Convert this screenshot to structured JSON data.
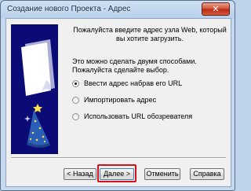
{
  "window": {
    "title": "Создание нового Проекта - Адрес",
    "close_glyph": "✕"
  },
  "wizard": {
    "intro_text": "Пожалуйста введите адрес узла Web, который вы хотите загрузить.",
    "method_text": "Это можно сделать двумя способами. Пожалуйста сделайте выбор.",
    "options": [
      {
        "label": "Ввести адрес набрав его URL",
        "checked": true
      },
      {
        "label": "Импортировать адрес",
        "checked": false
      },
      {
        "label": "Использовать URL обозревателя",
        "checked": false
      }
    ]
  },
  "buttons": {
    "back": "< Назад",
    "next": "Далее >",
    "cancel": "Отменить",
    "help": "Справка"
  },
  "colors": {
    "art_background": "#0b0b78",
    "highlight": "#d4141a"
  }
}
